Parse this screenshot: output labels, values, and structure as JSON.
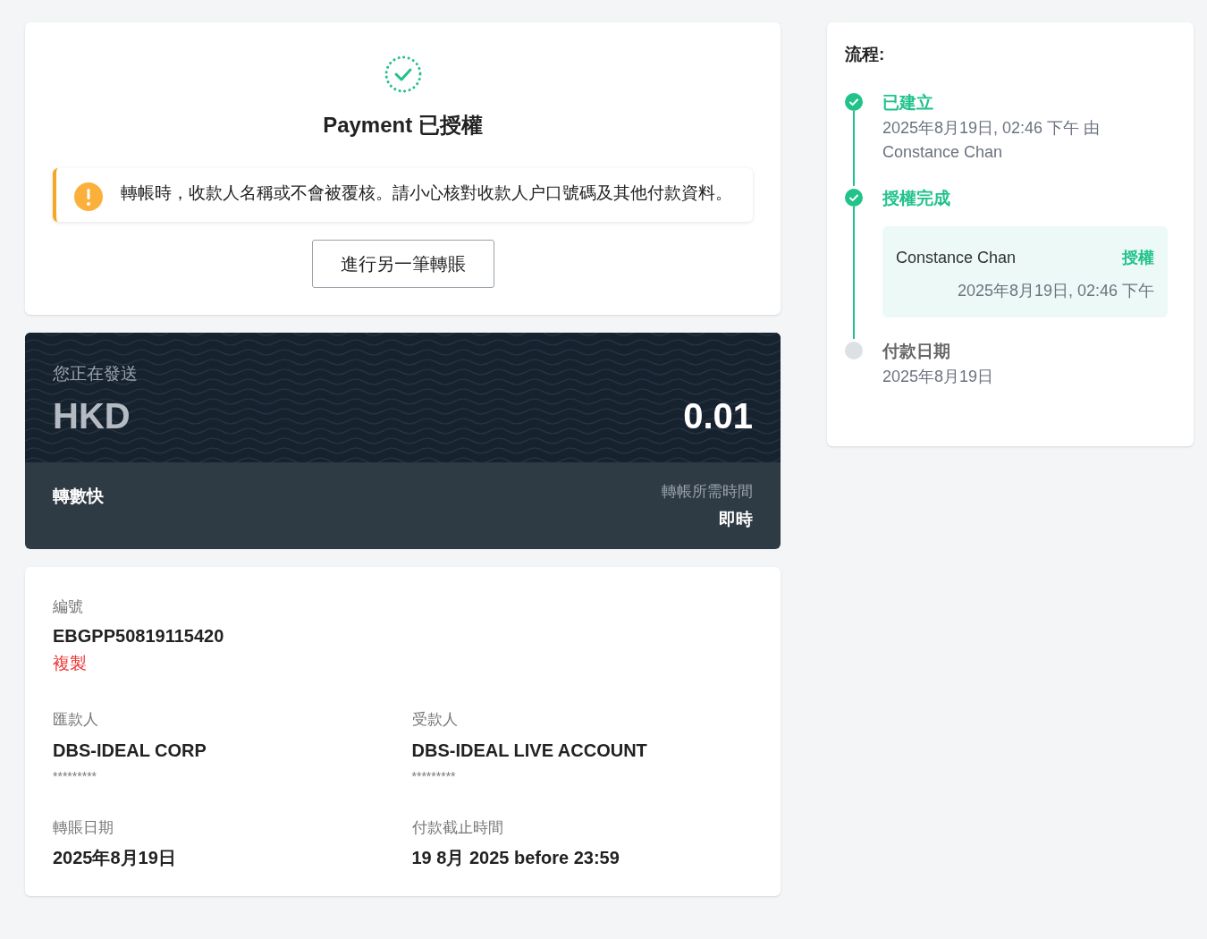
{
  "status": {
    "title": "Payment 已授權"
  },
  "notice": {
    "text": "轉帳時，收款人名稱或不會被覆核。請小心核對收款人户口號碼及其他付款資料。"
  },
  "action_button": "進行另一筆轉賬",
  "amount_card": {
    "label": "您正在發送",
    "currency": "HKD",
    "amount": "0.01",
    "method": "轉數快",
    "time_label": "轉帳所需時間",
    "time_value": "即時"
  },
  "details": {
    "reference": {
      "label": "編號",
      "value": "EBGPP50819115420",
      "copy": "複製"
    },
    "fields": [
      {
        "label": "匯款人",
        "value": "DBS-IDEAL CORP",
        "masked": "*********"
      },
      {
        "label": "受款人",
        "value": "DBS-IDEAL LIVE ACCOUNT",
        "masked": "*********"
      },
      {
        "label": "轉賬日期",
        "value": "2025年8月19日"
      },
      {
        "label": "付款截止時間",
        "value": "19 8月 2025 before 23:59"
      }
    ]
  },
  "workflow": {
    "title": "流程:",
    "steps": [
      {
        "title": "已建立",
        "done": true,
        "detail": "2025年8月19日, 02:46 下午 由 Constance Chan"
      },
      {
        "title": "授權完成",
        "done": true,
        "approval": {
          "name": "Constance Chan",
          "action": "授權",
          "time": "2025年8月19日, 02:46 下午"
        }
      },
      {
        "title": "付款日期",
        "done": false,
        "detail": "2025年8月19日"
      }
    ]
  }
}
